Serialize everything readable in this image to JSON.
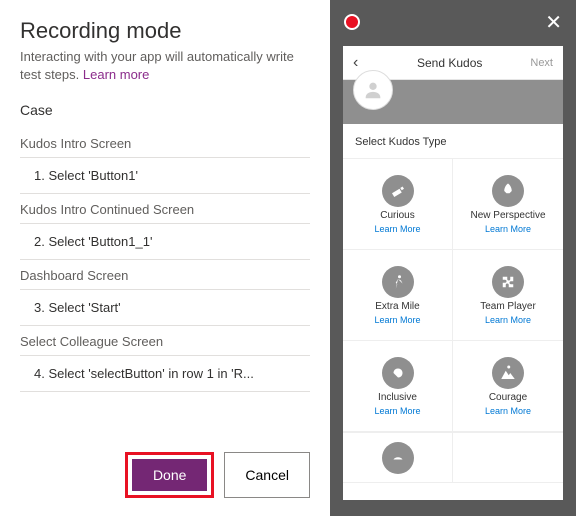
{
  "left": {
    "title": "Recording mode",
    "subtitle_pre": "Interacting with your app will automatically write test steps. ",
    "learn_more": "Learn more",
    "case_label": "Case",
    "sections": [
      {
        "header": "Kudos Intro Screen",
        "step": "1.  Select 'Button1'"
      },
      {
        "header": "Kudos Intro Continued Screen",
        "step": "2.  Select 'Button1_1'"
      },
      {
        "header": "Dashboard Screen",
        "step": "3.  Select 'Start'"
      },
      {
        "header": "Select Colleague Screen",
        "step": "4.  Select 'selectButton' in row 1 in 'R..."
      }
    ],
    "done": "Done",
    "cancel": "Cancel"
  },
  "phone": {
    "back": "‹",
    "title": "Send Kudos",
    "next": "Next",
    "select_label": "Select Kudos Type",
    "cards": [
      {
        "name": "Curious",
        "learn": "Learn More"
      },
      {
        "name": "New Perspective",
        "learn": "Learn More"
      },
      {
        "name": "Extra Mile",
        "learn": "Learn More"
      },
      {
        "name": "Team Player",
        "learn": "Learn More"
      },
      {
        "name": "Inclusive",
        "learn": "Learn More"
      },
      {
        "name": "Courage",
        "learn": "Learn More"
      }
    ]
  }
}
